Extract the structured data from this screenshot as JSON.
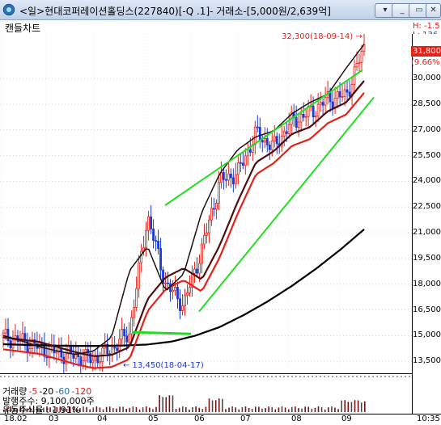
{
  "window": {
    "title": "<일>현대코퍼레이션홀딩스(227840)[-Q .1]- 거래소-[5,000원/2,639억]",
    "buttons": {
      "menu": "▾",
      "minimize": "_",
      "restore": "▭",
      "close": "✕"
    }
  },
  "chart_title": "캔들차트",
  "high_label": "H: -1.5",
  "low_label": "L: 136.",
  "current_price": "31,800",
  "change_pct": "(9.66%)",
  "annotations": {
    "high": "32,300(18-09-14) →",
    "low": "← 13,450(18-04-17)"
  },
  "volume_legend": {
    "label": "거래량",
    "ma5": "-5",
    "ma20": "-20",
    "ma60": "-60",
    "ma120": "-120"
  },
  "info": {
    "shares": "발행주수: 9,100,000주",
    "float_ratio": "유동주식율 : 1.91%"
  },
  "time_label": "10:35",
  "colors": {
    "up": "#e2211b",
    "down": "#1a39d8",
    "ma5": "#e2211b",
    "ma20": "#000000",
    "ma60": "#1f6fb2",
    "ma120": "#e2211b",
    "trendline": "#22dd22"
  },
  "chart_data": {
    "type": "candlestick",
    "y_ticks": [
      "30,000",
      "28,500",
      "27,000",
      "25,500",
      "24,000",
      "22,500",
      "21,000",
      "19,500",
      "18,000",
      "16,500",
      "15,000",
      "13,500"
    ],
    "x_ticks": [
      "18.02",
      "03",
      "04",
      "05",
      "06",
      "07",
      "08",
      "09"
    ],
    "ylim": [
      12800,
      32600
    ],
    "high": {
      "value": 32300,
      "date": "18-09-14"
    },
    "low": {
      "value": 13450,
      "date": "18-04-17"
    },
    "last_close": 31800,
    "ma_black": [
      14500,
      14450,
      14420,
      14400,
      14400,
      14420,
      14480,
      14650,
      15000,
      15500,
      16200,
      17000,
      17900,
      18900,
      20000,
      21200
    ],
    "price_path": [
      14900,
      14700,
      14300,
      14000,
      13800,
      13600,
      14200,
      15200,
      22000,
      18000,
      16800,
      20000,
      24000,
      24500,
      26800,
      26000,
      27500,
      28000,
      28800,
      29000,
      31800
    ]
  }
}
